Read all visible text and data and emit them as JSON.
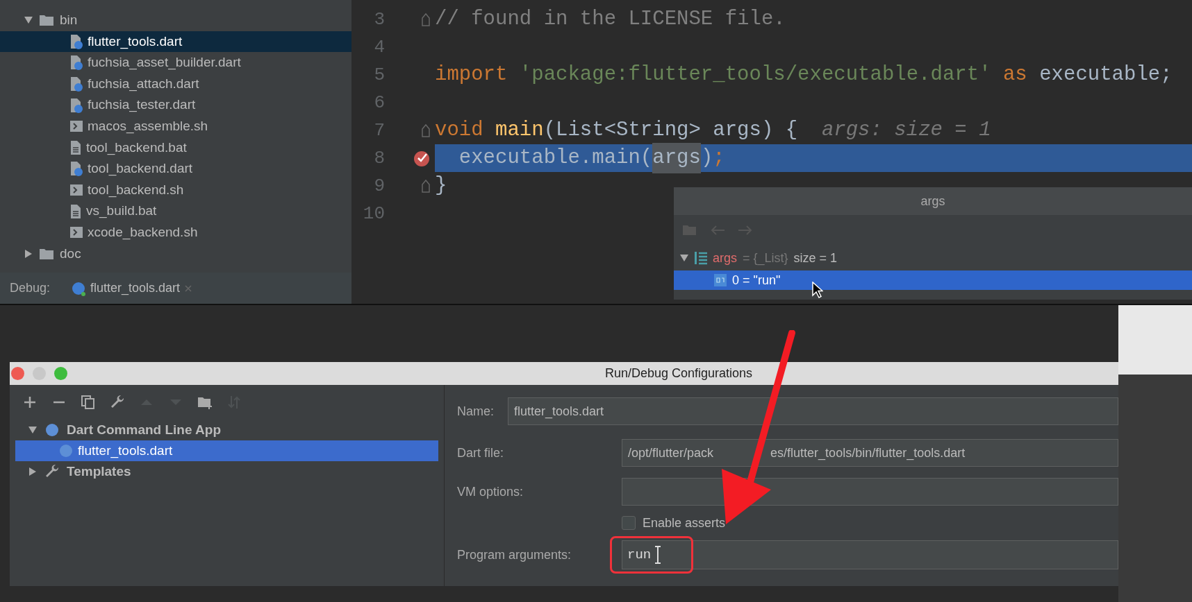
{
  "project_tree": {
    "items": [
      {
        "label": "bin",
        "kind": "folder",
        "expanded": true,
        "selected": false,
        "children": [
          {
            "label": "flutter_tools.dart",
            "kind": "dart",
            "selected": true
          },
          {
            "label": "fuchsia_asset_builder.dart",
            "kind": "dart",
            "selected": false
          },
          {
            "label": "fuchsia_attach.dart",
            "kind": "dart",
            "selected": false
          },
          {
            "label": "fuchsia_tester.dart",
            "kind": "dart",
            "selected": false
          },
          {
            "label": "macos_assemble.sh",
            "kind": "shell",
            "selected": false
          },
          {
            "label": "tool_backend.bat",
            "kind": "batch",
            "selected": false
          },
          {
            "label": "tool_backend.dart",
            "kind": "dart",
            "selected": false
          },
          {
            "label": "tool_backend.sh",
            "kind": "shell",
            "selected": false
          },
          {
            "label": "vs_build.bat",
            "kind": "batch",
            "selected": false
          },
          {
            "label": "xcode_backend.sh",
            "kind": "shell",
            "selected": false
          }
        ]
      },
      {
        "label": "doc",
        "kind": "folder",
        "expanded": false,
        "selected": false
      }
    ]
  },
  "debug_bar": {
    "label": "Debug:",
    "tab": "flutter_tools.dart"
  },
  "editor": {
    "lines": [
      {
        "number": "3",
        "fold": true,
        "breakpoint": false,
        "current": false,
        "tokens": [
          {
            "kind": "comment",
            "text": "// found in the LICENSE file."
          }
        ]
      },
      {
        "number": "4",
        "fold": false,
        "breakpoint": false,
        "current": false
      },
      {
        "number": "5",
        "fold": false,
        "breakpoint": false,
        "current": false,
        "tokens": [
          {
            "kind": "keyword",
            "text": "import "
          },
          {
            "kind": "string",
            "text": "'package:flutter_tools/executable.dart'"
          },
          {
            "kind": "keyword",
            "text": " as "
          },
          {
            "kind": "plain",
            "text": "executable;"
          }
        ]
      },
      {
        "number": "6",
        "fold": false,
        "breakpoint": false,
        "current": false
      },
      {
        "number": "7",
        "fold": true,
        "breakpoint": false,
        "current": false,
        "tokens": [
          {
            "kind": "keyword",
            "text": "void "
          },
          {
            "kind": "function",
            "text": "main"
          },
          {
            "kind": "plain",
            "text": "(List<String> args) {  "
          },
          {
            "kind": "hint",
            "text": "args: size = 1"
          }
        ]
      },
      {
        "number": "8",
        "fold": false,
        "breakpoint": true,
        "current": true,
        "tokens": [
          {
            "kind": "plain",
            "text": "  executable.main("
          },
          {
            "kind": "usage",
            "text": "args"
          },
          {
            "kind": "plain",
            "text": ")"
          },
          {
            "kind": "keyword",
            "text": ";"
          }
        ]
      },
      {
        "number": "9",
        "fold": true,
        "breakpoint": false,
        "current": false,
        "tokens": [
          {
            "kind": "plain",
            "text": "}"
          }
        ]
      },
      {
        "number": "10",
        "fold": false,
        "breakpoint": false,
        "current": false
      }
    ]
  },
  "variables_popup": {
    "title": "args",
    "variables": [
      {
        "name": "args",
        "type": "= {_List}",
        "value": "size = 1",
        "expanded": true,
        "selected": false,
        "children": [
          {
            "name": "0 = \"run\"",
            "selected": true
          }
        ]
      }
    ]
  },
  "dialog": {
    "title": "Run/Debug Configurations",
    "toolbar": [
      {
        "kind": "add",
        "disabled": false
      },
      {
        "kind": "remove",
        "disabled": false
      },
      {
        "kind": "copy",
        "disabled": false
      },
      {
        "kind": "wrench",
        "disabled": false
      },
      {
        "kind": "up",
        "disabled": true
      },
      {
        "kind": "down",
        "disabled": true
      },
      {
        "kind": "folder",
        "disabled": false
      },
      {
        "kind": "sort",
        "disabled": true
      }
    ],
    "configurations": [
      {
        "label": "Dart Command Line App",
        "kind": "dart",
        "expanded": true,
        "selected": false,
        "children": [
          {
            "label": "flutter_tools.dart",
            "kind": "dart",
            "selected": true
          }
        ]
      },
      {
        "label": "Templates",
        "kind": "wrench",
        "expanded": false,
        "selected": false
      }
    ],
    "name": {
      "label": "Name:",
      "value": "flutter_tools.dart"
    },
    "fields": [
      {
        "label": "Dart file:",
        "value_parts": [
          "/opt/flutter/pack",
          "es/flutter_tools/bin/flutter_tools.dart"
        ]
      },
      {
        "label": "VM options:"
      }
    ],
    "enable_asserts": {
      "label": "Enable asserts",
      "checked": false
    },
    "program_arguments": {
      "label": "Program arguments:",
      "value": "run",
      "highlighted": true
    }
  }
}
